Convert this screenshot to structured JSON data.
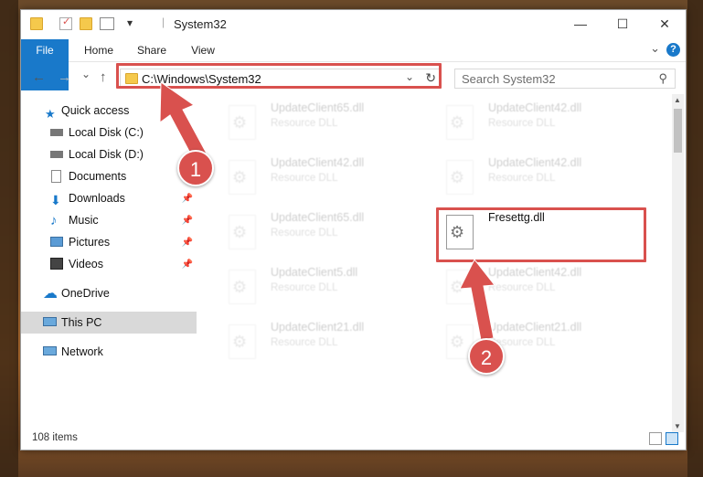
{
  "window": {
    "title": "System32",
    "minimize": "—",
    "maximize": "☐",
    "close": "✕"
  },
  "ribbon": {
    "tabs": [
      "File",
      "Home",
      "Share",
      "View"
    ],
    "expand": "⌄",
    "help": "?"
  },
  "nav": {
    "back": "←",
    "forward": "→",
    "recent": "⌄",
    "up": "↑",
    "address": "C:\\Windows\\System32",
    "address_dropdown": "⌄",
    "refresh": "↻",
    "search_placeholder": "Search System32",
    "search_icon": "⚲"
  },
  "sidebar": {
    "items": [
      {
        "label": "Quick access",
        "icon": "star-icon",
        "pinned": false
      },
      {
        "label": "Local Disk (C:)",
        "icon": "drive-icon",
        "pinned": true
      },
      {
        "label": "Local Disk (D:)",
        "icon": "drive-icon",
        "pinned": false
      },
      {
        "label": "Documents",
        "icon": "documents-icon",
        "pinned": true
      },
      {
        "label": "Downloads",
        "icon": "download-icon",
        "pinned": true
      },
      {
        "label": "Music",
        "icon": "music-icon",
        "pinned": true
      },
      {
        "label": "Pictures",
        "icon": "pictures-icon",
        "pinned": true
      },
      {
        "label": "Videos",
        "icon": "videos-icon",
        "pinned": true
      },
      {
        "label": "OneDrive",
        "icon": "cloud-icon",
        "pinned": false
      },
      {
        "label": "This PC",
        "icon": "computer-icon",
        "pinned": false,
        "selected": true
      },
      {
        "label": "Network",
        "icon": "network-icon",
        "pinned": false
      }
    ]
  },
  "files": [
    {
      "name": "UpdateClient65.dll",
      "type": "Resource DLL",
      "faded": true
    },
    {
      "name": "UpdateClient42.dll",
      "type": "Resource DLL",
      "faded": true
    },
    {
      "name": "UpdateClient42.dll",
      "type": "Resource DLL",
      "faded": true
    },
    {
      "name": "UpdateClient42.dll",
      "type": "Resource DLL",
      "faded": true
    },
    {
      "name": "UpdateClient65.dll",
      "type": "Resource DLL",
      "faded": true
    },
    {
      "name": "Fresettg.dll",
      "type": "",
      "faded": false
    },
    {
      "name": "UpdateClient5.dll",
      "type": "Resource DLL",
      "faded": true
    },
    {
      "name": "UpdateClient42.dll",
      "type": "Resource DLL",
      "faded": true
    },
    {
      "name": "UpdateClient21.dll",
      "type": "Resource DLL",
      "faded": true
    },
    {
      "name": "UpdateClient21.dll",
      "type": "Resource DLL",
      "faded": true
    }
  ],
  "status": {
    "item_count": "108 items"
  },
  "annotations": {
    "step1": "1",
    "step2": "2",
    "color": "#d9514e"
  }
}
